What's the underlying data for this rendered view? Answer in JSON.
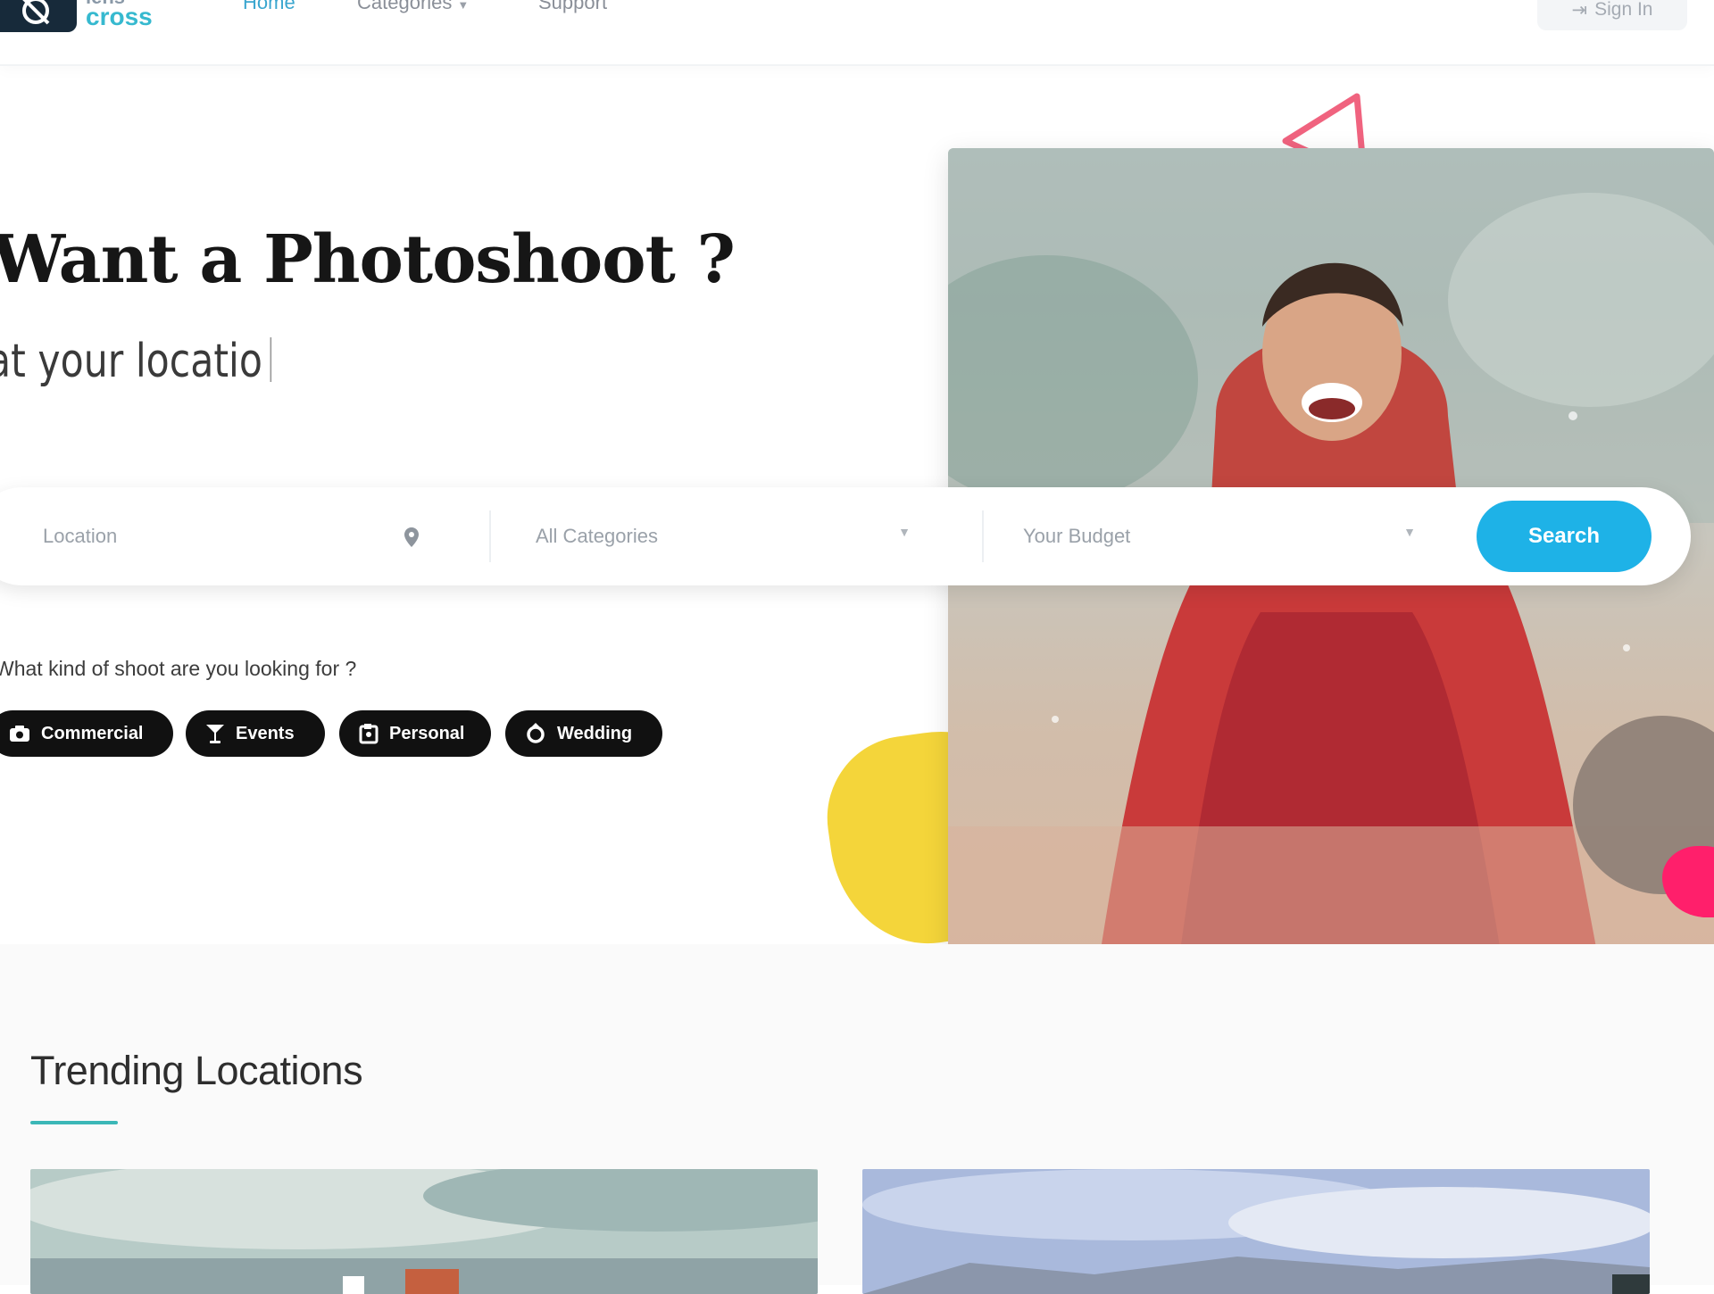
{
  "brand": {
    "line1": "lens",
    "line2": "cross"
  },
  "nav": {
    "home": "Home",
    "categories": "Categories",
    "support": "Support",
    "signin": "Sign In"
  },
  "hero": {
    "title": "Want a Photoshoot ?",
    "subtitle": "at your locatio"
  },
  "search": {
    "location_placeholder": "Location",
    "category_value": "All Categories",
    "budget_value": "Your Budget",
    "button": "Search"
  },
  "shoot": {
    "question": "What kind of shoot are you looking for ?",
    "chips": [
      {
        "label": "Commercial",
        "icon": "camera-icon"
      },
      {
        "label": "Events",
        "icon": "cocktail-glass-icon"
      },
      {
        "label": "Personal",
        "icon": "person-portrait-icon"
      },
      {
        "label": "Wedding",
        "icon": "ring-icon"
      }
    ]
  },
  "slider": {
    "total_slides": 4,
    "active_slide": 2
  },
  "trending": {
    "title": "Trending Locations"
  },
  "colors": {
    "accent": "#1eb2e7",
    "brand_teal": "#36b9cf",
    "chip_bg": "#111111",
    "yellow_blob": "#f4d53a",
    "pink_blob": "#ff1f6b",
    "triangle": "#f0637f"
  }
}
